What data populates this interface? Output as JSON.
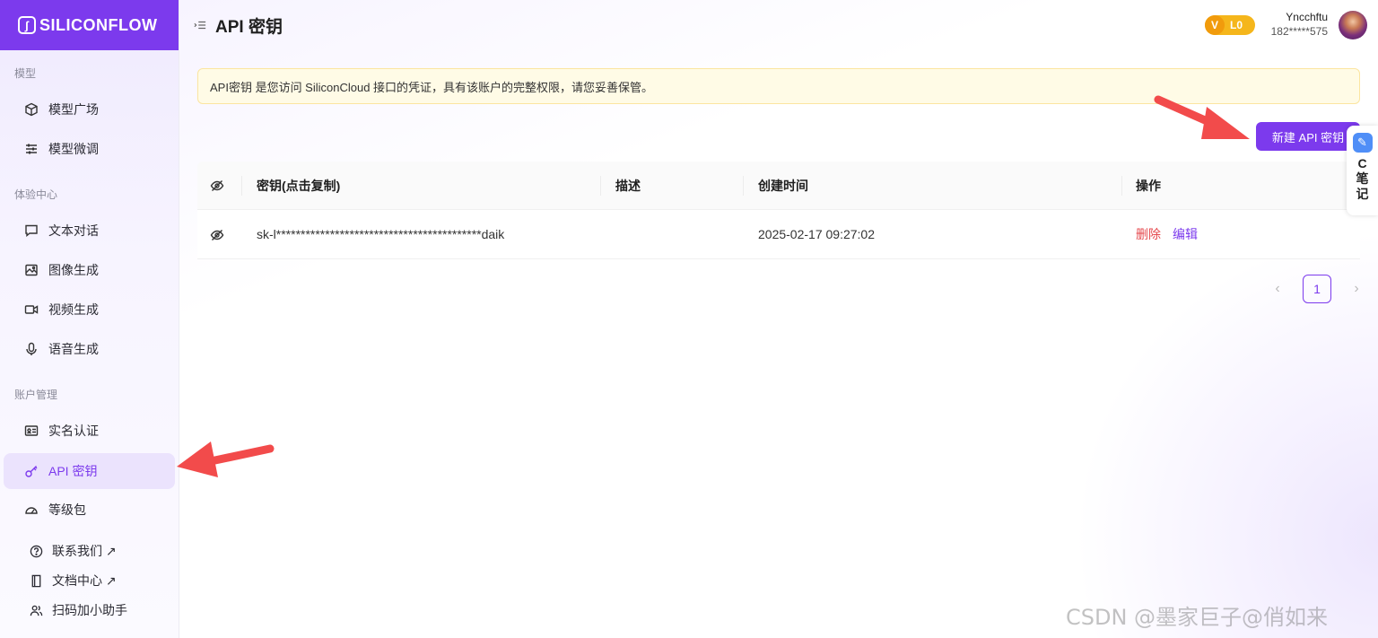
{
  "brand": {
    "name": "SILICONFLOW"
  },
  "sidebar": {
    "groups": [
      {
        "label": "模型"
      },
      {
        "label": "体验中心"
      },
      {
        "label": "账户管理"
      }
    ],
    "items": [
      {
        "label": "模型广场",
        "icon": "cube-icon"
      },
      {
        "label": "模型微调",
        "icon": "sliders-icon"
      },
      {
        "label": "文本对话",
        "icon": "chat-icon"
      },
      {
        "label": "图像生成",
        "icon": "image-icon"
      },
      {
        "label": "视频生成",
        "icon": "video-icon"
      },
      {
        "label": "语音生成",
        "icon": "mic-icon"
      },
      {
        "label": "实名认证",
        "icon": "id-card-icon"
      },
      {
        "label": "API 密钥",
        "icon": "key-icon",
        "active": true
      },
      {
        "label": "等级包",
        "icon": "gauge-icon"
      }
    ],
    "links": [
      {
        "label": "联系我们 ↗",
        "icon": "question-icon"
      },
      {
        "label": "文档中心 ↗",
        "icon": "book-icon"
      },
      {
        "label": "扫码加小助手",
        "icon": "users-icon"
      }
    ]
  },
  "header": {
    "title": "API 密钥"
  },
  "user": {
    "level": "L0",
    "level_prefix": "V",
    "name": "Yncchftu",
    "phone": "182*****575"
  },
  "notice": {
    "text": "API密钥 是您访问 SiliconCloud 接口的凭证，具有该账户的完整权限，请您妥善保管。"
  },
  "actions": {
    "new_key": "新建 API 密钥"
  },
  "table": {
    "columns": [
      "密钥(点击复制)",
      "描述",
      "创建时间",
      "操作"
    ],
    "rows": [
      {
        "key": "sk-l******************************************daik",
        "description": "",
        "created": "2025-02-17 09:27:02",
        "delete": "删除",
        "edit": "编辑"
      }
    ]
  },
  "pagination": {
    "current": "1"
  },
  "side_widget": {
    "label": "C笔记"
  },
  "watermark": {
    "text": "CSDN @墨家巨子@俏如来"
  },
  "colors": {
    "accent": "#7c3aed",
    "danger": "#e5484d",
    "annotation_arrow": "#f24b4b",
    "notice_bg": "#fffbe6"
  }
}
